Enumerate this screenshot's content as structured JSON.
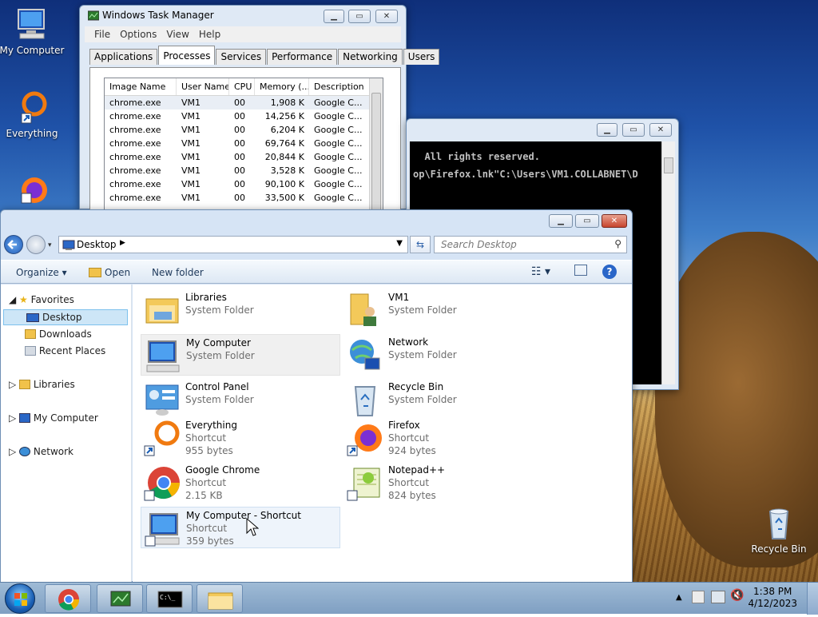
{
  "desktop": {
    "icons": [
      {
        "label": "My Computer"
      },
      {
        "label": "Everything"
      },
      {
        "label": ""
      },
      {
        "label": "Recycle Bin"
      }
    ]
  },
  "taskmgr": {
    "title": "Windows Task Manager",
    "menu": [
      "File",
      "Options",
      "View",
      "Help"
    ],
    "tabs": [
      "Applications",
      "Processes",
      "Services",
      "Performance",
      "Networking",
      "Users"
    ],
    "active_tab": "Processes",
    "columns": [
      "Image Name",
      "User Name",
      "CPU",
      "Memory (...",
      "Description"
    ],
    "rows": [
      [
        "chrome.exe",
        "VM1",
        "00",
        "1,908 K",
        "Google C..."
      ],
      [
        "chrome.exe",
        "VM1",
        "00",
        "14,256 K",
        "Google C..."
      ],
      [
        "chrome.exe",
        "VM1",
        "00",
        "6,204 K",
        "Google C..."
      ],
      [
        "chrome.exe",
        "VM1",
        "00",
        "69,764 K",
        "Google C..."
      ],
      [
        "chrome.exe",
        "VM1",
        "00",
        "20,844 K",
        "Google C..."
      ],
      [
        "chrome.exe",
        "VM1",
        "00",
        "3,528 K",
        "Google C..."
      ],
      [
        "chrome.exe",
        "VM1",
        "00",
        "90,100 K",
        "Google C..."
      ],
      [
        "chrome.exe",
        "VM1",
        "00",
        "33,500 K",
        "Google C..."
      ]
    ]
  },
  "console": {
    "line1": "  All rights reserved.",
    "line2": "op\\Firefox.lnk\"C:\\Users\\VM1.COLLABNET\\D"
  },
  "explorer": {
    "address": "Desktop",
    "search_placeholder": "Search Desktop",
    "commands": {
      "organize": "Organize",
      "open": "Open",
      "new_folder": "New folder"
    },
    "nav": {
      "favorites": "Favorites",
      "desktop": "Desktop",
      "downloads": "Downloads",
      "recent": "Recent Places",
      "libraries": "Libraries",
      "computer": "My Computer",
      "network": "Network"
    },
    "items": [
      {
        "name": "Libraries",
        "type": "System Folder",
        "size": ""
      },
      {
        "name": "VM1",
        "type": "System Folder",
        "size": ""
      },
      {
        "name": "My Computer",
        "type": "System Folder",
        "size": ""
      },
      {
        "name": "Network",
        "type": "System Folder",
        "size": ""
      },
      {
        "name": "Control Panel",
        "type": "System Folder",
        "size": ""
      },
      {
        "name": "Recycle Bin",
        "type": "System Folder",
        "size": ""
      },
      {
        "name": "Everything",
        "type": "Shortcut",
        "size": "955 bytes"
      },
      {
        "name": "Firefox",
        "type": "Shortcut",
        "size": "924 bytes"
      },
      {
        "name": "Google Chrome",
        "type": "Shortcut",
        "size": "2.15 KB"
      },
      {
        "name": "Notepad++",
        "type": "Shortcut",
        "size": "824 bytes"
      },
      {
        "name": "My Computer - Shortcut",
        "type": "Shortcut",
        "size": "359 bytes"
      }
    ]
  },
  "taskbar": {
    "time": "1:38 PM",
    "date": "4/12/2023"
  }
}
